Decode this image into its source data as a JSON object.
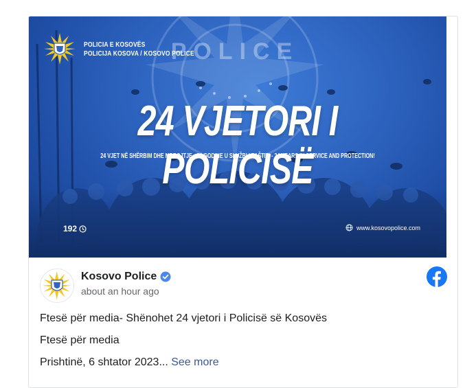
{
  "banner": {
    "org_line1": "POLICIA E KOSOVËS",
    "org_line2": "POLICIJA KOSOVA / KOSOVO POLICE",
    "watermark": "POLICE",
    "headline": "24 VJETORI I POLICISË",
    "subline": "24 VJET NË SHËRBIM DHE MBROJTJE - 24 GODINE U SLUŽBI I ZAŠTITI - 24 YEARS IN SERVICE AND PROTECTION!",
    "views": "192",
    "website": "www.kosovopolice.com"
  },
  "post": {
    "page_name": "Kosovo Police",
    "timestamp": "about an hour ago",
    "line1": "Ftesë për media- Shënohet 24 vjetori i Policisë së Kosovës",
    "line2": "Ftesë për media",
    "line3": "Prishtinë, 6 shtator 2023...",
    "see_more": "See more"
  },
  "colors": {
    "facebook_blue": "#1877f2",
    "verified_blue": "#4a88ea",
    "link_blue": "#385898",
    "banner_blue": "#2f66c2"
  },
  "icons": {
    "verified": "verified-badge-icon",
    "facebook": "facebook-logo-icon",
    "views": "clock-icon",
    "website": "globe-icon"
  }
}
